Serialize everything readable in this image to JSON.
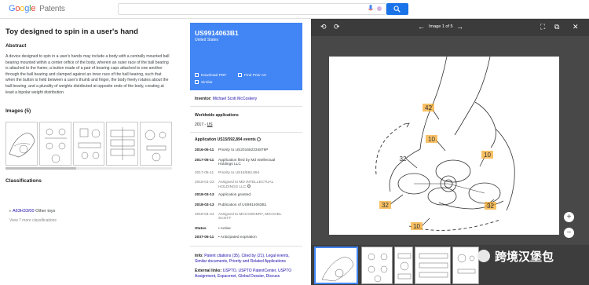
{
  "header": {
    "logo_letters": [
      "G",
      "o",
      "o",
      "g",
      "l",
      "e"
    ],
    "logo_suffix": "Patents",
    "search": {
      "value": "",
      "placeholder": ""
    }
  },
  "doc": {
    "title": "Toy designed to spin in a user's hand",
    "abstract_heading": "Abstract",
    "abstract": "A device designed to spin in a user's hands may include a body with a centrally mounted ball bearing mounted within a center orifice of the body, wherein an outer race of the ball bearing is attached to the frame; a button made of a pair of bearing caps attached to one another through the ball bearing and clamped against an inner race of the ball bearing, such that when the button is held between a user's thumb and finger, the body freely rotates about the ball bearing; and a plurality of weights distributed at opposite ends of the body, creating at least a bipolar weight distribution.",
    "images_heading": "Images (5)",
    "classifications_heading": "Classifications",
    "classification_code": "A63H33/00",
    "classification_label": "Other toys",
    "more_classifications": "View 7 more classifications"
  },
  "panel": {
    "pub_number": "US9914063B1",
    "country": "United States",
    "download_pdf": "Download PDF",
    "find_prior_art": "Find Prior Art",
    "similar": "Similar",
    "inventor_label": "Inventor:",
    "inventor": "Michael Scott McCoskery",
    "worldwide_heading": "Worldwide applications",
    "worldwide_year": "2017 -",
    "worldwide_country": "US",
    "application_heading": "Application US15/592,894 events",
    "events": [
      {
        "date": "2016-05-11",
        "text": "Priority to US201662334879P",
        "grey": false
      },
      {
        "date": "2017-05-11",
        "text": "Application filed by Md Intellectual",
        "text2": "Holdings LLC",
        "grey": false
      },
      {
        "date": "2017-05-11",
        "text": "Priority to US15/592,894",
        "grey": true
      },
      {
        "date": "2018-01-23",
        "text": "Assigned to MD INTELLECTUAL",
        "text2": "HOLDINGS LLC",
        "grey": true
      },
      {
        "date": "2018-03-13",
        "text": "Application granted",
        "grey": false
      },
      {
        "date": "2018-03-13",
        "text": "Publication of US9914063B1",
        "grey": false
      },
      {
        "date": "2018-04-24",
        "text": "Assigned to MCCOSKERY, MICHAEL",
        "text2": "SCOTT",
        "grey": true
      }
    ],
    "status_label": "Status",
    "status_value": "Active",
    "expiration_date": "2037-05-11",
    "expiration_label": "Anticipated expiration",
    "info_label": "Info:",
    "info_links": "Patent citations (35), Cited by (21), Legal events,",
    "info_links2": "Similar documents, Priority and Related Applications",
    "external_label": "External links:",
    "external_links": "USPTO, USPTO PatentCenter, USPTO",
    "external_links2": "Assignment, Espacenet, Global Dossier, Discuss"
  },
  "viewer": {
    "page_label": "Image 1 of 5",
    "callouts": [
      "42",
      "10",
      "32",
      "10",
      "32",
      "32",
      "10"
    ],
    "colors": {
      "viewer_bg": "#484848",
      "toolbar_bg": "#3b3b3b",
      "accent": "#4285f4",
      "callout": "#f5a623"
    }
  },
  "watermark": {
    "text": "跨境汉堡包"
  }
}
